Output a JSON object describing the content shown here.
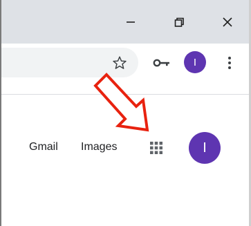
{
  "window_controls": {
    "minimize_icon": "minimize-icon",
    "restore_icon": "restore-icon",
    "close_icon": "close-icon"
  },
  "toolbar": {
    "bookmark_icon": "star-icon",
    "password_icon": "key-icon",
    "profile_initial": "I",
    "menu_icon": "kebab-menu-icon"
  },
  "google_header": {
    "gmail_label": "Gmail",
    "images_label": "Images",
    "apps_icon": "apps-grid-icon",
    "account_initial": "I"
  },
  "colors": {
    "titlebar": "#dee1e6",
    "avatar": "#5e35b1",
    "arrow": "#e8220f",
    "omnibox": "#f1f3f4"
  }
}
